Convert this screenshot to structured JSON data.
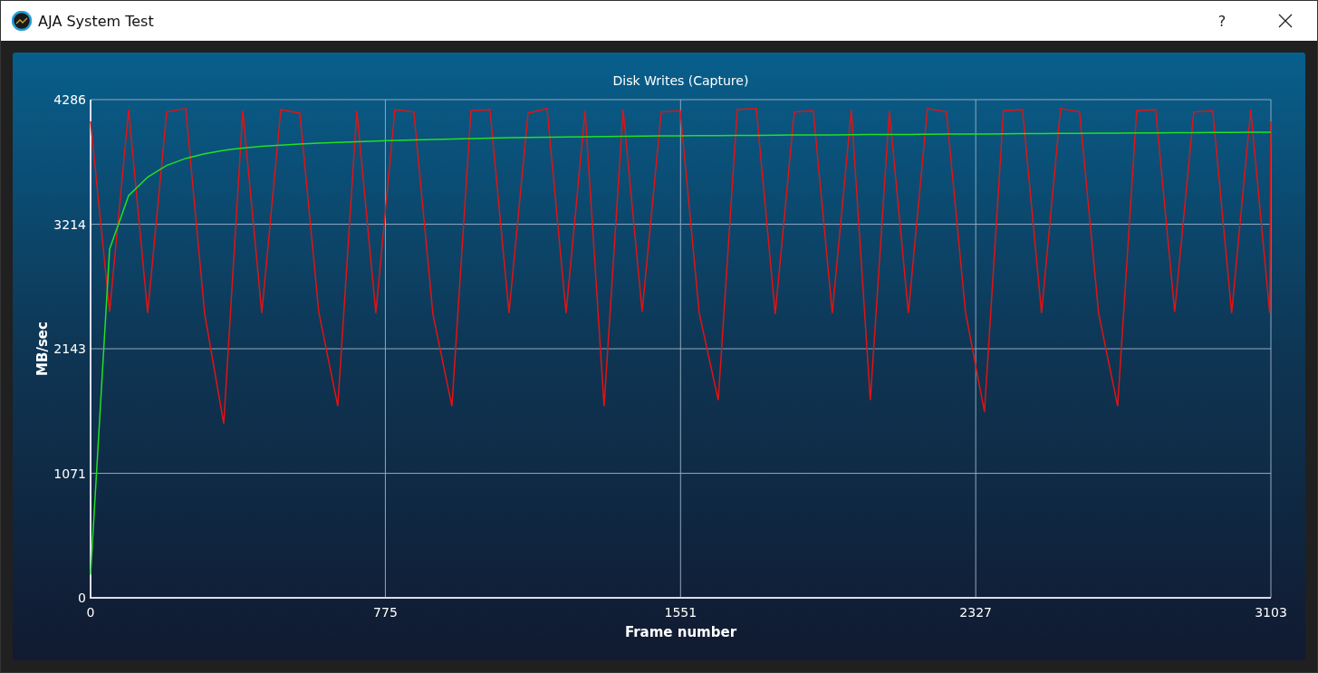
{
  "window": {
    "title": "AJA System Test",
    "help": "?"
  },
  "chart": {
    "chart_data": {
      "type": "line",
      "title": "Disk Writes (Capture)",
      "xlabel": "Frame number",
      "ylabel": "MB/sec",
      "x": [
        0,
        50,
        100,
        150,
        200,
        250,
        300,
        350,
        400,
        450,
        500,
        550,
        600,
        650,
        700,
        750,
        800,
        850,
        900,
        950,
        1000,
        1050,
        1100,
        1150,
        1200,
        1250,
        1300,
        1350,
        1400,
        1450,
        1500,
        1550,
        1600,
        1650,
        1700,
        1750,
        1800,
        1850,
        1900,
        1950,
        2000,
        2050,
        2100,
        2150,
        2200,
        2250,
        2300,
        2350,
        2400,
        2450,
        2500,
        2550,
        2600,
        2650,
        2700,
        2750,
        2800,
        2850,
        2900,
        2950,
        3000,
        3050,
        3100,
        3103
      ],
      "series": [
        {
          "color": "#e01414",
          "values": [
            4100,
            2460,
            4200,
            2450,
            4180,
            4210,
            2440,
            1500,
            4190,
            2450,
            4200,
            4170,
            2460,
            1650,
            4190,
            2450,
            4200,
            4180,
            2440,
            1650,
            4190,
            4200,
            2450,
            4170,
            4210,
            2450,
            4190,
            1650,
            4200,
            2460,
            4180,
            4190,
            2450,
            1700,
            4200,
            4210,
            2440,
            4180,
            4190,
            2450,
            4200,
            1700,
            4190,
            2450,
            4210,
            4180,
            2460,
            1600,
            4190,
            4200,
            2450,
            4210,
            4180,
            2450,
            1650,
            4190,
            4200,
            2460,
            4180,
            4190,
            2450,
            4200,
            2450,
            4100
          ]
        },
        {
          "color": "#22e022",
          "values": [
            200,
            3000,
            3460,
            3620,
            3720,
            3780,
            3820,
            3850,
            3870,
            3885,
            3895,
            3905,
            3912,
            3918,
            3924,
            3930,
            3935,
            3940,
            3944,
            3948,
            3952,
            3955,
            3958,
            3960,
            3962,
            3964,
            3966,
            3968,
            3970,
            3972,
            3974,
            3975,
            3976,
            3977,
            3978,
            3979,
            3980,
            3981,
            3982,
            3983,
            3984,
            3985,
            3986,
            3987,
            3988,
            3989,
            3990,
            3991,
            3992,
            3993,
            3994,
            3995,
            3996,
            3997,
            3998,
            3999,
            4000,
            4001,
            4002,
            4003,
            4004,
            4005,
            4006,
            4006
          ]
        }
      ],
      "grid": true,
      "xlim": [
        0,
        3103
      ],
      "ylim": [
        0,
        4286
      ],
      "xticks": [
        0,
        775,
        1551,
        2327,
        3103
      ],
      "yticks": [
        0,
        1071,
        2143,
        3214,
        4286
      ]
    }
  }
}
